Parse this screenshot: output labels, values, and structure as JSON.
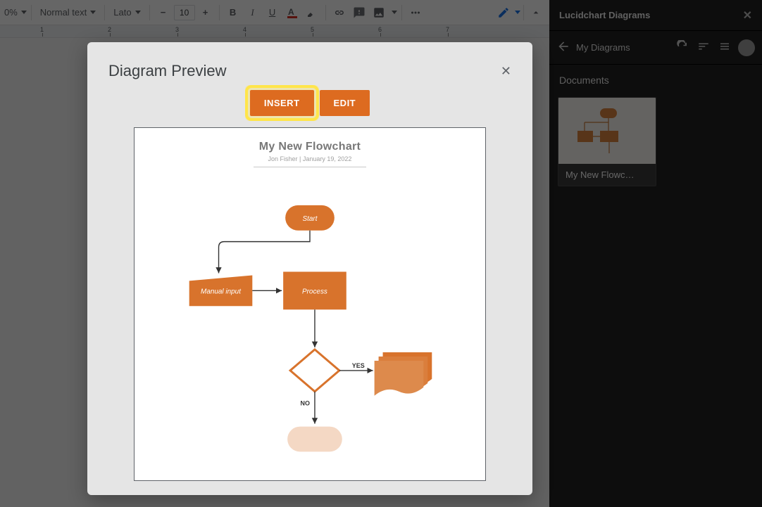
{
  "toolbar": {
    "zoom": "0%",
    "style_dropdown": "Normal text",
    "font_dropdown": "Lato",
    "font_size": "10"
  },
  "sidebar": {
    "panel_title": "Lucidchart Diagrams",
    "nav_label": "My Diagrams",
    "section_label": "Documents",
    "thumb_label": "My New Flowc…"
  },
  "modal": {
    "title": "Diagram Preview",
    "insert_label": "INSERT",
    "edit_label": "EDIT",
    "flow_title": "My New Flowchart",
    "flow_author": "Jon Fisher  |   January 19, 2022"
  },
  "flow": {
    "start": "Start",
    "manual": "Manual input",
    "process": "Process",
    "yes": "YES",
    "no": "NO"
  }
}
